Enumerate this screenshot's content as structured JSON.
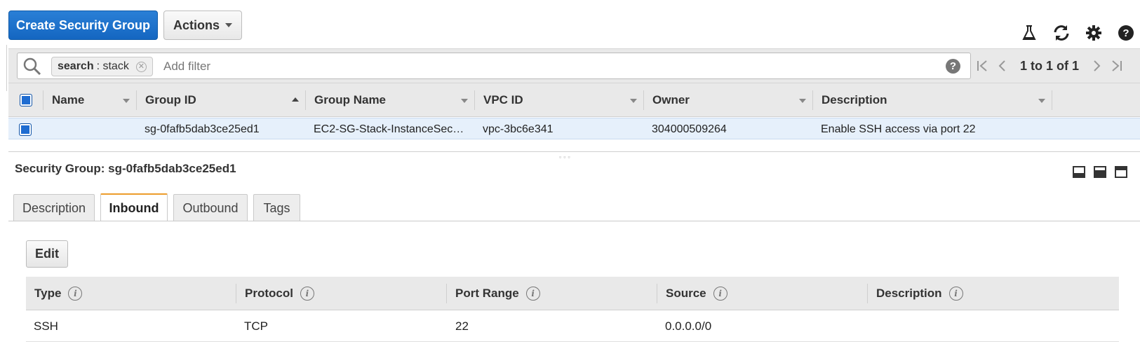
{
  "toolbar": {
    "create_label": "Create Security Group",
    "actions_label": "Actions",
    "icons": [
      "flask-icon",
      "refresh-icon",
      "gear-icon",
      "help-icon"
    ]
  },
  "filter": {
    "token_key": "search",
    "token_value": ": stack",
    "placeholder": "Add filter"
  },
  "pager": {
    "text": "1 to 1 of 1"
  },
  "grid": {
    "columns": [
      "Name",
      "Group ID",
      "Group Name",
      "VPC ID",
      "Owner",
      "Description"
    ],
    "sorted_column": "Group ID",
    "rows": [
      {
        "name": "",
        "group_id": "sg-0fafb5dab3ce25ed1",
        "group_name": "EC2-SG-Stack-InstanceSec…",
        "vpc_id": "vpc-3bc6e341",
        "owner": "304000509264",
        "description": "Enable SSH access via port 22"
      }
    ]
  },
  "details": {
    "title": "Security Group: sg-0fafb5dab3ce25ed1",
    "tabs": [
      "Description",
      "Inbound",
      "Outbound",
      "Tags"
    ],
    "active_tab": "Inbound",
    "edit_label": "Edit",
    "rules_columns": [
      "Type",
      "Protocol",
      "Port Range",
      "Source",
      "Description"
    ],
    "rules": [
      {
        "type": "SSH",
        "protocol": "TCP",
        "port_range": "22",
        "source": "0.0.0.0/0",
        "description": ""
      }
    ]
  },
  "colors": {
    "primary": "#1466c1",
    "active_tab_accent": "#ec9c2a",
    "selected_row": "#e6f0fb"
  }
}
